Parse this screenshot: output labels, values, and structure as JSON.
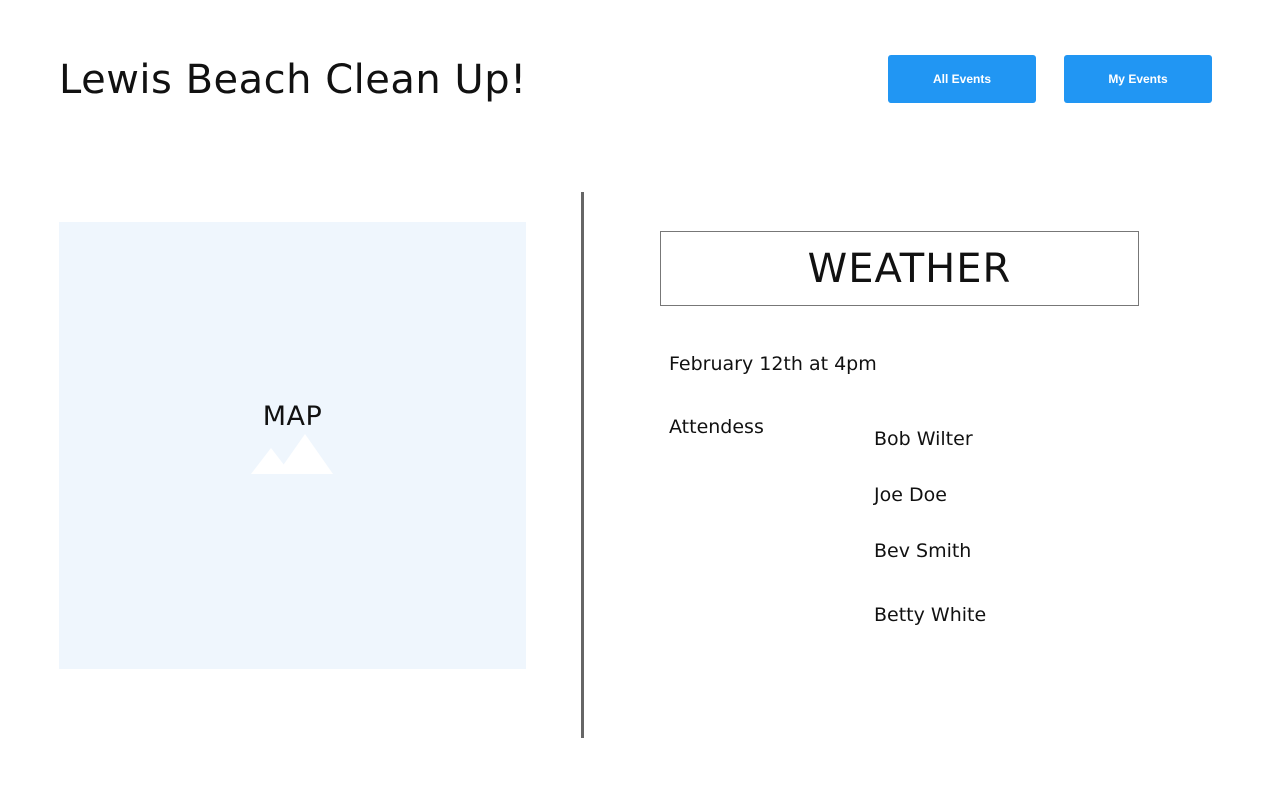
{
  "header": {
    "title": "Lewis Beach Clean Up!",
    "all_events_label": "All Events",
    "my_events_label": "My Events"
  },
  "map": {
    "label": "MAP",
    "icon": "image-placeholder-icon"
  },
  "weather": {
    "label": "WEATHER"
  },
  "event": {
    "date": "February 12th at 4pm",
    "attendees_label": "Attendess",
    "attendees": [
      "Bob Wilter",
      "Joe Doe",
      "Bev Smith",
      "Betty White"
    ]
  },
  "colors": {
    "button": "#2196f3",
    "button_text": "#ffffff",
    "map_background": "#eff6fd",
    "divider": "#666666",
    "weather_border": "#777777",
    "text": "#111111",
    "page_background": "#ffffff"
  }
}
